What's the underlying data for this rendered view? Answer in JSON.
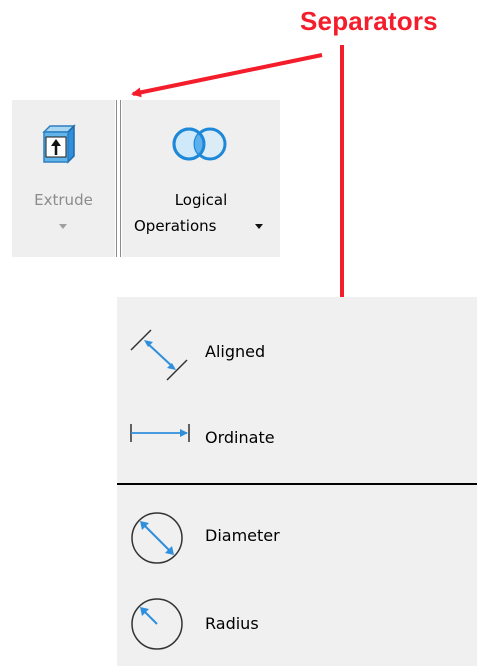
{
  "annotation": {
    "label": "Separators",
    "color": "#f41d2b"
  },
  "ribbon": {
    "extrude": {
      "label": "Extrude",
      "enabled": false,
      "icon": "extrude-icon"
    },
    "logical": {
      "label_line1": "Logical",
      "label_line2": "Operations",
      "icon": "logical-operations-icon"
    }
  },
  "dimension_menu": {
    "items_top": [
      {
        "label": "Aligned",
        "icon": "aligned-dimension-icon"
      },
      {
        "label": "Ordinate",
        "icon": "ordinate-dimension-icon"
      }
    ],
    "items_bottom": [
      {
        "label": "Diameter",
        "icon": "diameter-dimension-icon"
      },
      {
        "label": "Radius",
        "icon": "radius-dimension-icon"
      }
    ]
  },
  "colors": {
    "accent_blue": "#2f8fdc",
    "panel_bg": "#f0f0f0",
    "ribbon_bg": "#efefef"
  }
}
